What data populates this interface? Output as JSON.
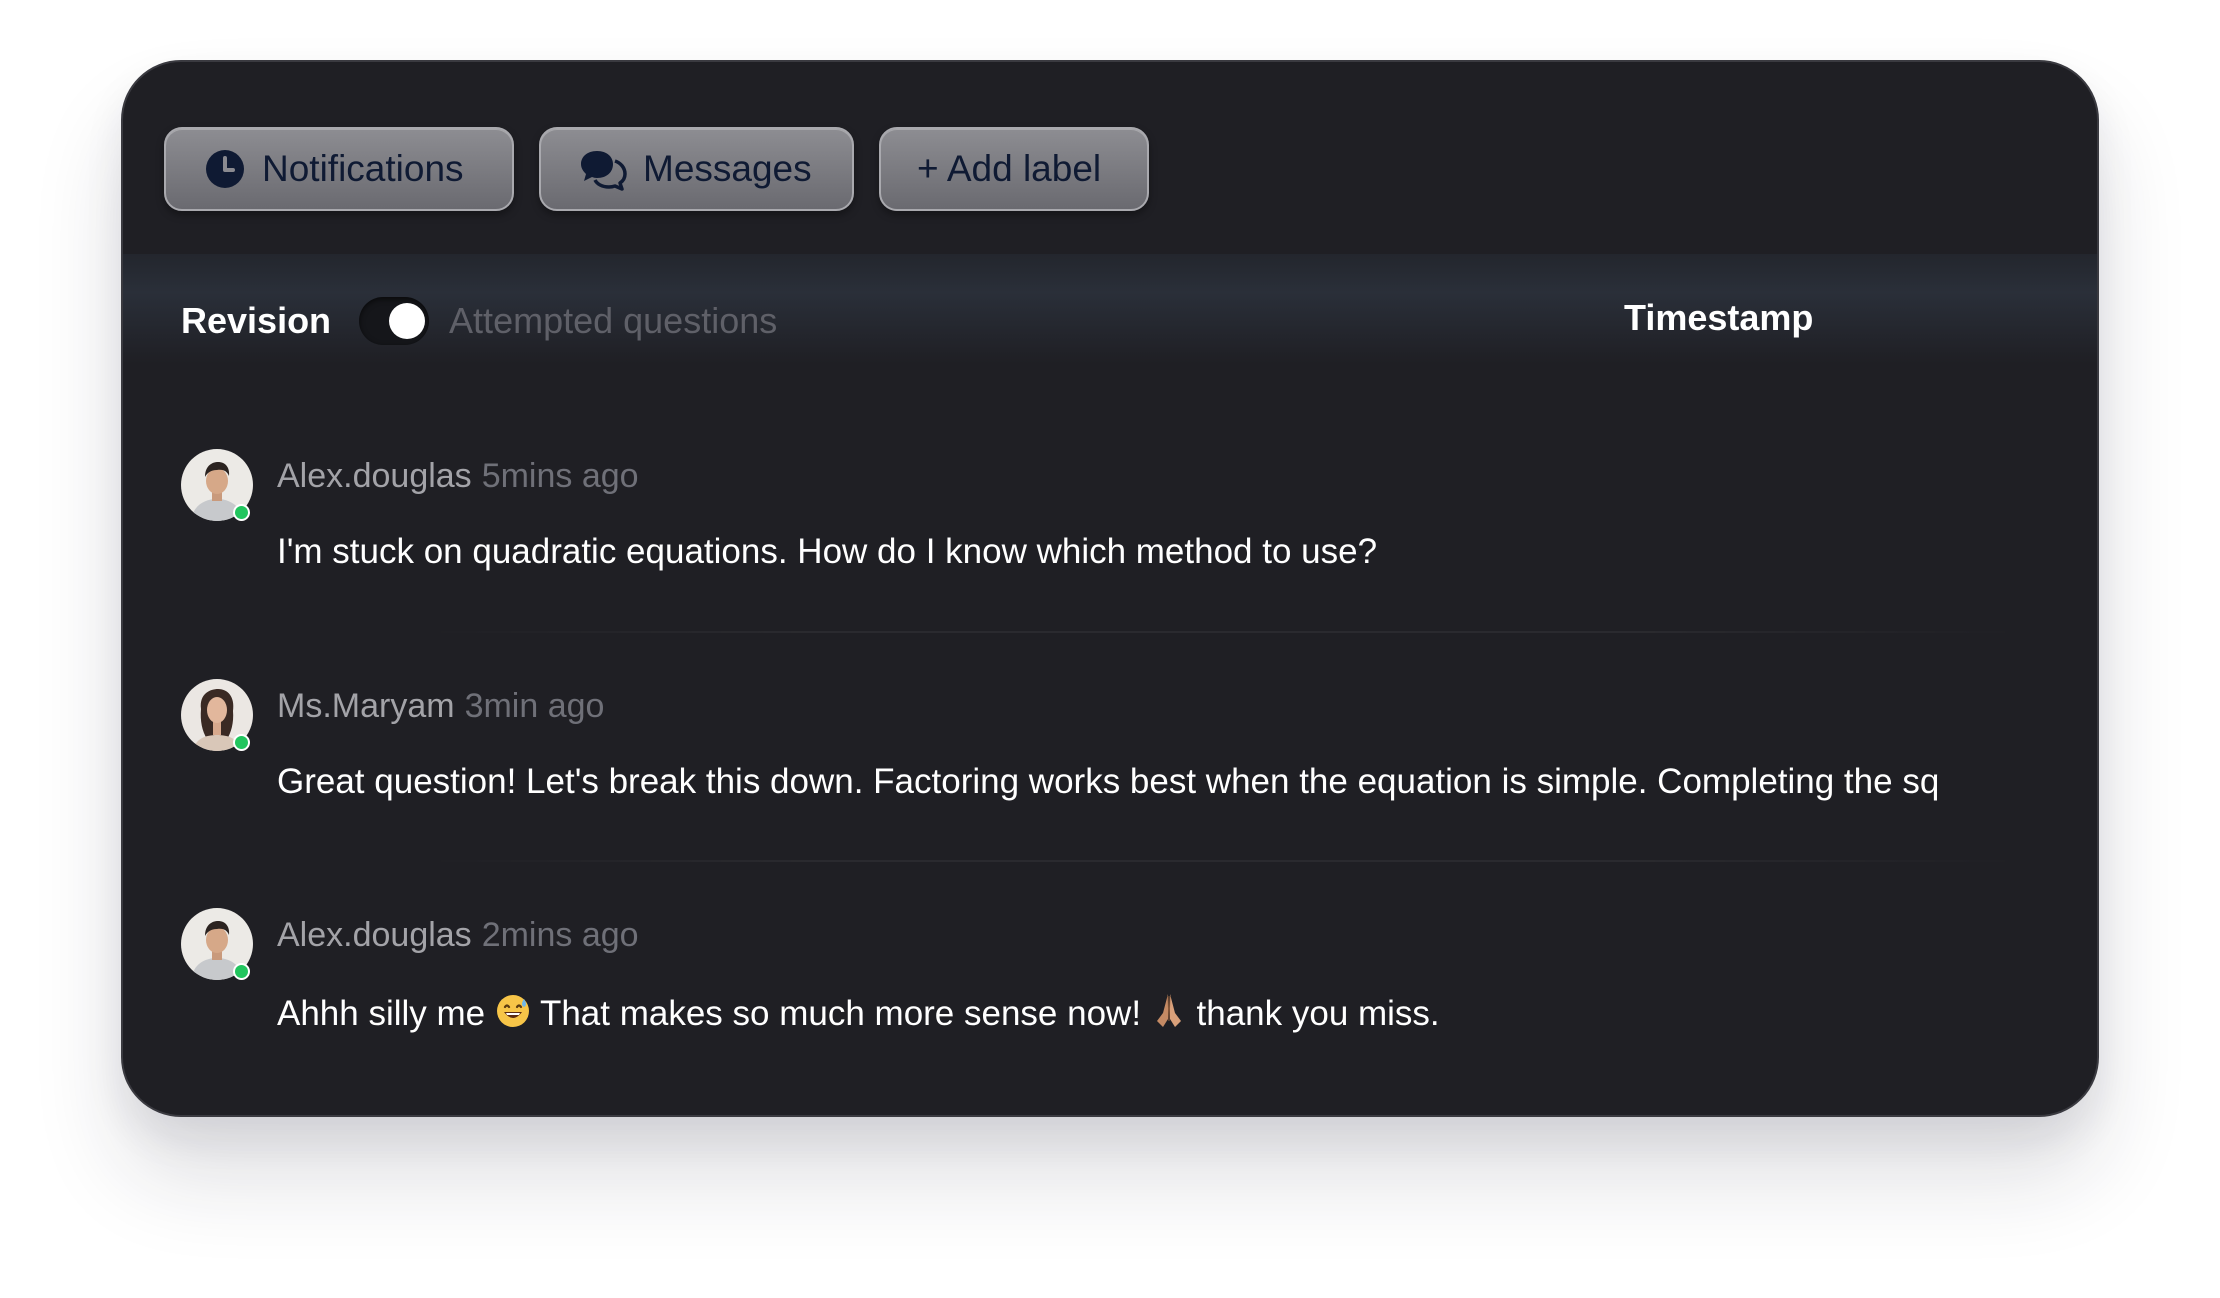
{
  "toolbar": {
    "notifications_label": "Notifications",
    "notifications_icon": "clock-icon",
    "messages_label": "Messages",
    "messages_icon": "chat-bubbles-icon",
    "add_label": "+ Add label"
  },
  "header": {
    "revision_label": "Revision",
    "toggle_state": "on",
    "attempted_label": "Attempted questions",
    "timestamp_label": "Timestamp"
  },
  "messages": [
    {
      "author": "Alex.douglas",
      "time": "5mins ago",
      "text": "I'm stuck on quadratic equations. How do I know which method to use?",
      "online": true
    },
    {
      "author": "Ms.Maryam",
      "time": "3min ago",
      "text": "Great question! Let's break this down. Factoring works best when the equation is simple. Completing the sq",
      "online": true
    },
    {
      "author": "Alex.douglas",
      "time": "2mins ago",
      "text_part1": "Ahhh silly me ",
      "emoji1": "grinning-sweat-emoji",
      "text_part2": " That makes so much more sense now! ",
      "emoji2": "folded-hands-emoji",
      "text_part3": " thank you miss.",
      "online": true
    }
  ],
  "colors": {
    "card_background": "#1f1f24",
    "button_gradient_top": "#8d8d92",
    "button_text": "#0f1a33",
    "online": "#22c55e",
    "muted_text": "#6f7078"
  }
}
